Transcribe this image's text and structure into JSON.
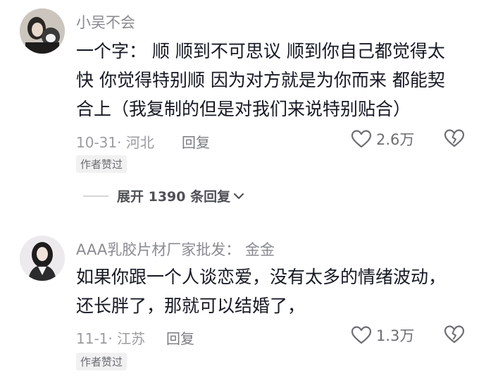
{
  "comments": [
    {
      "username": "小吴不会",
      "lines": [
        "一个字： 顺 顺到不可思议 顺到你自己都觉得太",
        "快 你觉得特别顺 因为对方就是为你而来 都能契",
        "合上（我复制的但是对我们来说特别贴合）"
      ],
      "meta": "10-31· 河北",
      "reply_label": "回复",
      "like_count": "2.6万",
      "badge": "作者赞过"
    },
    {
      "username": "AAA乳胶片材厂家批发",
      "mention": "： 金金",
      "lines": [
        "如果你跟一个人谈恋爱，没有太多的情绪波动，",
        "还长胖了，那就可以结婚了，"
      ],
      "meta": "11-1· 江苏",
      "reply_label": "回复",
      "like_count": "1.3万",
      "badge": "作者赞过"
    }
  ],
  "expand_replies": {
    "label": "展开 1390 条回复"
  },
  "icons": {
    "like": "heart-outline-icon",
    "dislike": "broken-heart-icon",
    "expand": "chevron-down-icon"
  }
}
